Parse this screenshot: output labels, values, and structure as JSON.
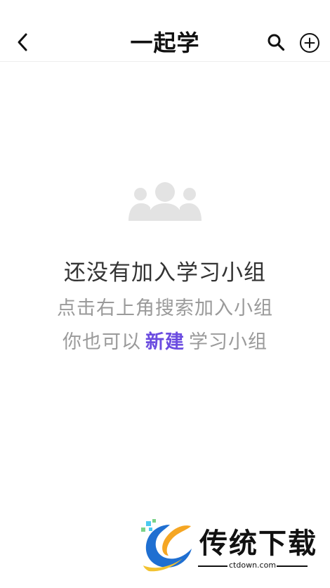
{
  "header": {
    "title": "一起学",
    "back_icon": "chevron-left-icon",
    "search_icon": "search-icon",
    "add_icon": "plus-circle-icon"
  },
  "empty_state": {
    "icon": "group-people-icon",
    "title": "还没有加入学习小组",
    "hint": "点击右上角搜索加入小组",
    "create_prefix": "你也可以",
    "create_link": "新建",
    "create_suffix": "学习小组"
  },
  "watermark": {
    "brand": "传统下载",
    "url": "ctdown.com"
  },
  "colors": {
    "accent": "#6b4ce0",
    "muted_text": "#9a9a9a",
    "icon_gray": "#e3e3e3"
  }
}
